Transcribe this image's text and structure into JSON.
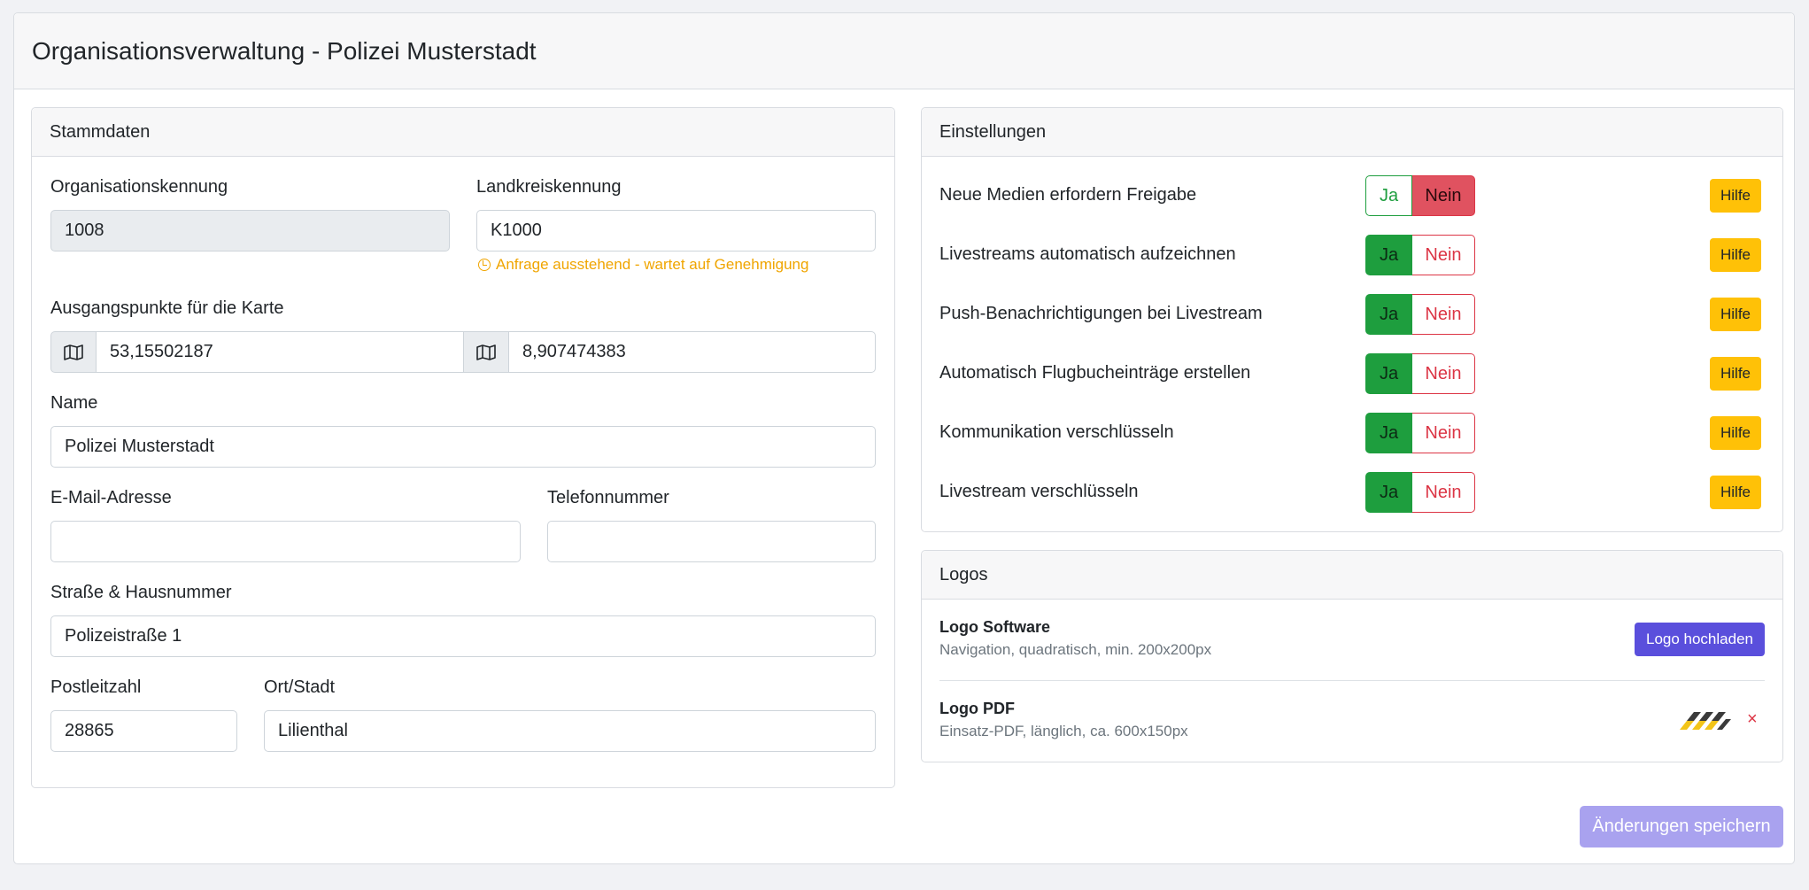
{
  "page": {
    "title": "Organisationsverwaltung - Polizei Musterstadt"
  },
  "stammdaten": {
    "heading": "Stammdaten",
    "org_id": {
      "label": "Organisationskennung",
      "value": "1008"
    },
    "district_id": {
      "label": "Landkreiskennung",
      "value": "K1000",
      "hint": "Anfrage ausstehend - wartet auf Genehmigung"
    },
    "map_start": {
      "label": "Ausgangspunkte für die Karte",
      "lat": "53,15502187",
      "lng": "8,907474383"
    },
    "name": {
      "label": "Name",
      "value": "Polizei Musterstadt"
    },
    "email": {
      "label": "E-Mail-Adresse",
      "value": ""
    },
    "phone": {
      "label": "Telefonnummer",
      "value": ""
    },
    "street": {
      "label": "Straße & Hausnummer",
      "value": "Polizeistraße 1"
    },
    "zip": {
      "label": "Postleitzahl",
      "value": "28865"
    },
    "city": {
      "label": "Ort/Stadt",
      "value": "Lilienthal"
    }
  },
  "einstellungen": {
    "heading": "Einstellungen",
    "yes_label": "Ja",
    "no_label": "Nein",
    "help_label": "Hilfe",
    "items": [
      {
        "label": "Neue Medien erfordern Freigabe",
        "selected": "Nein"
      },
      {
        "label": "Livestreams automatisch aufzeichnen",
        "selected": "Ja"
      },
      {
        "label": "Push-Benachrichtigungen bei Livestream",
        "selected": "Ja"
      },
      {
        "label": "Automatisch Flugbucheinträge erstellen",
        "selected": "Ja"
      },
      {
        "label": "Kommunikation verschlüsseln",
        "selected": "Ja"
      },
      {
        "label": "Livestream verschlüsseln",
        "selected": "Ja"
      }
    ]
  },
  "logos": {
    "heading": "Logos",
    "software": {
      "name": "Logo Software",
      "desc": "Navigation, quadratisch, min. 200x200px",
      "upload_label": "Logo hochladen"
    },
    "pdf": {
      "name": "Logo PDF",
      "desc": "Einsatz-PDF, länglich, ca. 600x150px",
      "remove_label": "×"
    }
  },
  "footer": {
    "save_label": "Änderungen speichern"
  },
  "colors": {
    "success": "#1e9e3e",
    "danger": "#dc3545",
    "warning": "#ffc107",
    "primary": "#5a4fdc"
  }
}
